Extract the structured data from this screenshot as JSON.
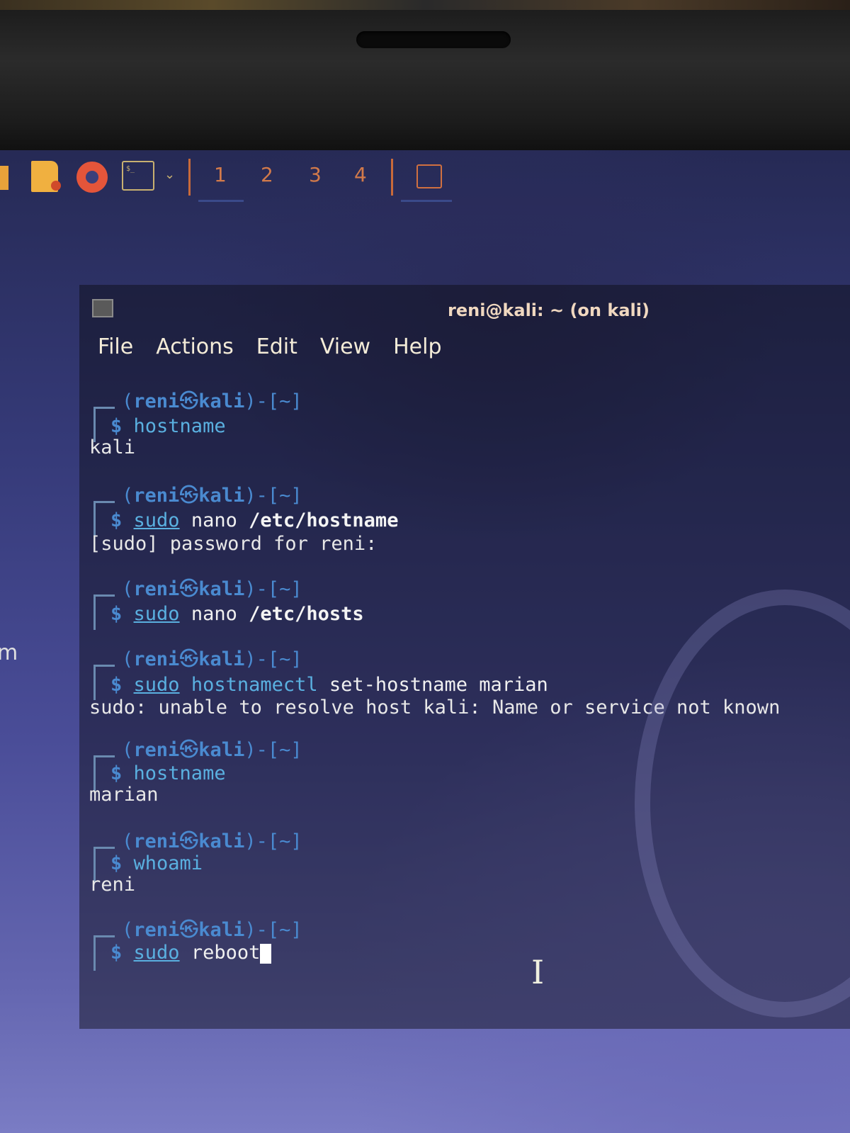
{
  "panel": {
    "workspaces": [
      "1",
      "2",
      "3",
      "4"
    ],
    "icons": [
      "folder-icon",
      "files-icon",
      "browser-icon",
      "terminal-icon",
      "chevron-down-icon",
      "window-icon"
    ],
    "terminal_icon_text": "$_"
  },
  "window": {
    "title": "reni@kali: ~ (on kali)",
    "menu": [
      "File",
      "Actions",
      "Edit",
      "View",
      "Help"
    ]
  },
  "prompt": {
    "open": "(",
    "user": "reni",
    "at_symbol": "㉿",
    "host": "kali",
    "close": ")-[~]",
    "dollar": "$"
  },
  "session": [
    {
      "sudo": "",
      "command": "hostname",
      "args": "",
      "output": "kali"
    },
    {
      "sudo": "sudo",
      "command": "nano",
      "args": "/etc/hostname",
      "output": "[sudo] password for reni:"
    },
    {
      "sudo": "sudo",
      "command": "nano",
      "args": "/etc/hosts",
      "output": ""
    },
    {
      "sudo": "sudo",
      "command": "hostnamectl",
      "args": "set-hostname marian",
      "output": "sudo: unable to resolve host kali: Name or service not known"
    },
    {
      "sudo": "",
      "command": "hostname",
      "args": "",
      "output": "marian"
    },
    {
      "sudo": "",
      "command": "whoami",
      "args": "",
      "output": "reni"
    },
    {
      "sudo": "sudo",
      "command": "reboot",
      "args": "",
      "output": ""
    }
  ],
  "desktop_edge_text": "m"
}
